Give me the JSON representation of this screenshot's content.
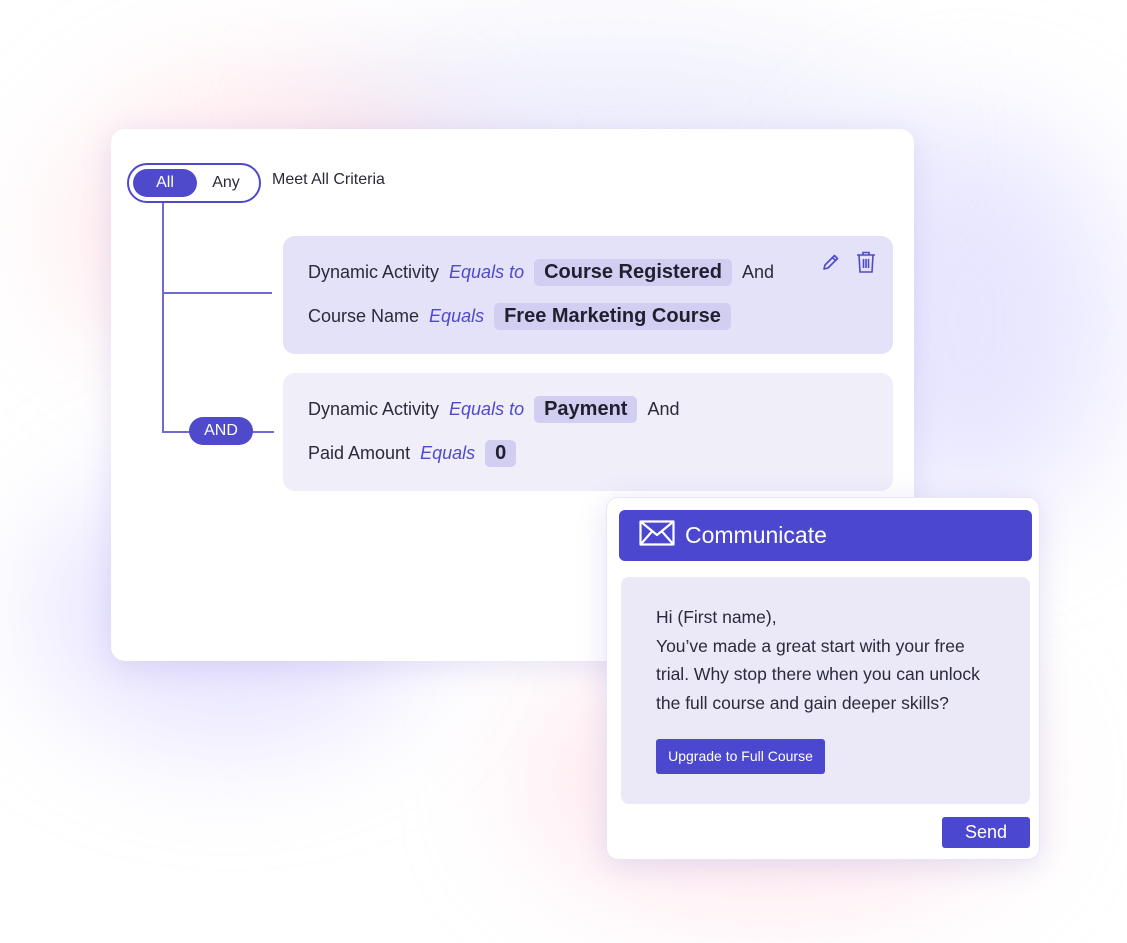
{
  "filter": {
    "toggle_all": "All",
    "toggle_any": "Any",
    "criteria_label": "Meet All Criteria",
    "and_label": "AND"
  },
  "conditions": [
    {
      "lines": [
        {
          "field": "Dynamic Activity",
          "operator": "Equals to",
          "value": "Course Registered",
          "join": "And"
        },
        {
          "field": "Course Name",
          "operator": "Equals",
          "value": "Free Marketing Course"
        }
      ],
      "actions": [
        "pencil-icon",
        "trash-icon"
      ]
    },
    {
      "lines": [
        {
          "field": "Dynamic Activity",
          "operator": "Equals to",
          "value": "Payment",
          "join": "And"
        },
        {
          "field": "Paid Amount",
          "operator": "Equals",
          "value": "0"
        }
      ]
    }
  ],
  "communicate": {
    "icon": "envelope-icon",
    "title": "Communicate",
    "greeting": "Hi (First name),",
    "message_lines": [
      "You’ve made a great start with your free",
      "trial. Why stop there when you can unlock",
      "the full course and gain deeper skills?"
    ],
    "upgrade_label": "Upgrade to Full Course",
    "send_label": "Send"
  },
  "colors": {
    "accent": "#4b47cf",
    "condition_bg": "#e4e2f8",
    "value_chip": "#d1cef2"
  }
}
